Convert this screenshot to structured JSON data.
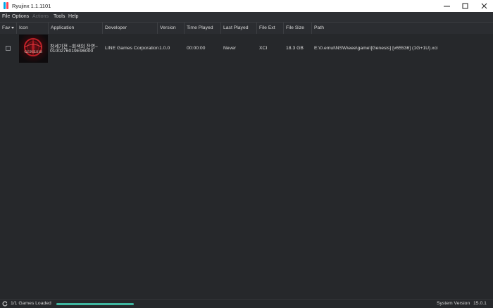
{
  "window": {
    "title": "Ryujinx 1.1.1101",
    "minimize": "—",
    "maximize": "☐",
    "close": "✕"
  },
  "menu": [
    {
      "label": "File",
      "enabled": true
    },
    {
      "label": "Options",
      "enabled": true
    },
    {
      "label": "Actions",
      "enabled": false
    },
    {
      "label": "Tools",
      "enabled": true
    },
    {
      "label": "Help",
      "enabled": true
    }
  ],
  "columns": [
    "Fav",
    "Icon",
    "Application",
    "Developer",
    "Version",
    "Time Played",
    "Last Played",
    "File Ext",
    "File Size",
    "Path"
  ],
  "games": [
    {
      "favorite": false,
      "icon": "genesis-game-icon",
      "icon_text": "GENESIS",
      "title": "창세기전 ~회색의 잔영~",
      "title_id": "0100276019E96000",
      "developer": "LINE Games Corporation",
      "version": "1.0.0",
      "time_played": "00:00:00",
      "last_played": "Never",
      "file_ext": "XCI",
      "file_size": "18.3 GB",
      "path": "E:\\0.emul\\NSW\\eee\\game\\[Genesis] [v65536] (1G+1U).xci"
    }
  ],
  "status": {
    "refresh_icon": "refresh-icon",
    "games_loaded": "1/1 Games Loaded",
    "progress": 1.0,
    "system_version_label": "System Version",
    "system_version": "15.0.1"
  },
  "colors": {
    "accent": "#3fb6a0",
    "background": "#26282b"
  }
}
